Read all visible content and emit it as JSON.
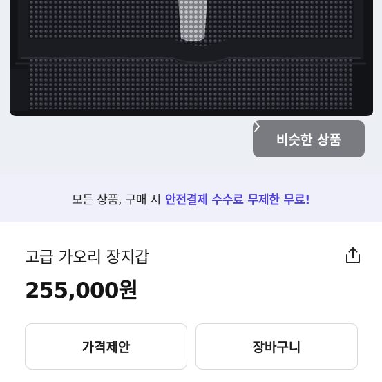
{
  "product": {
    "image_alt_icon": "wallet-photo",
    "similar_button_label": "비슷한 상품",
    "title": "고급 가오리 장지갑",
    "price": "255,000원"
  },
  "promo": {
    "prefix": "모든 상품, 구매 시",
    "highlight": "안전결제 수수료 무제한 무료!",
    "highlight_color": "#4b3fd6",
    "background": "#eff0fa"
  },
  "actions": {
    "offer_label": "가격제안",
    "cart_label": "장바구니"
  },
  "icons": {
    "share": "share-icon",
    "chevron": "chevron-right-icon"
  }
}
